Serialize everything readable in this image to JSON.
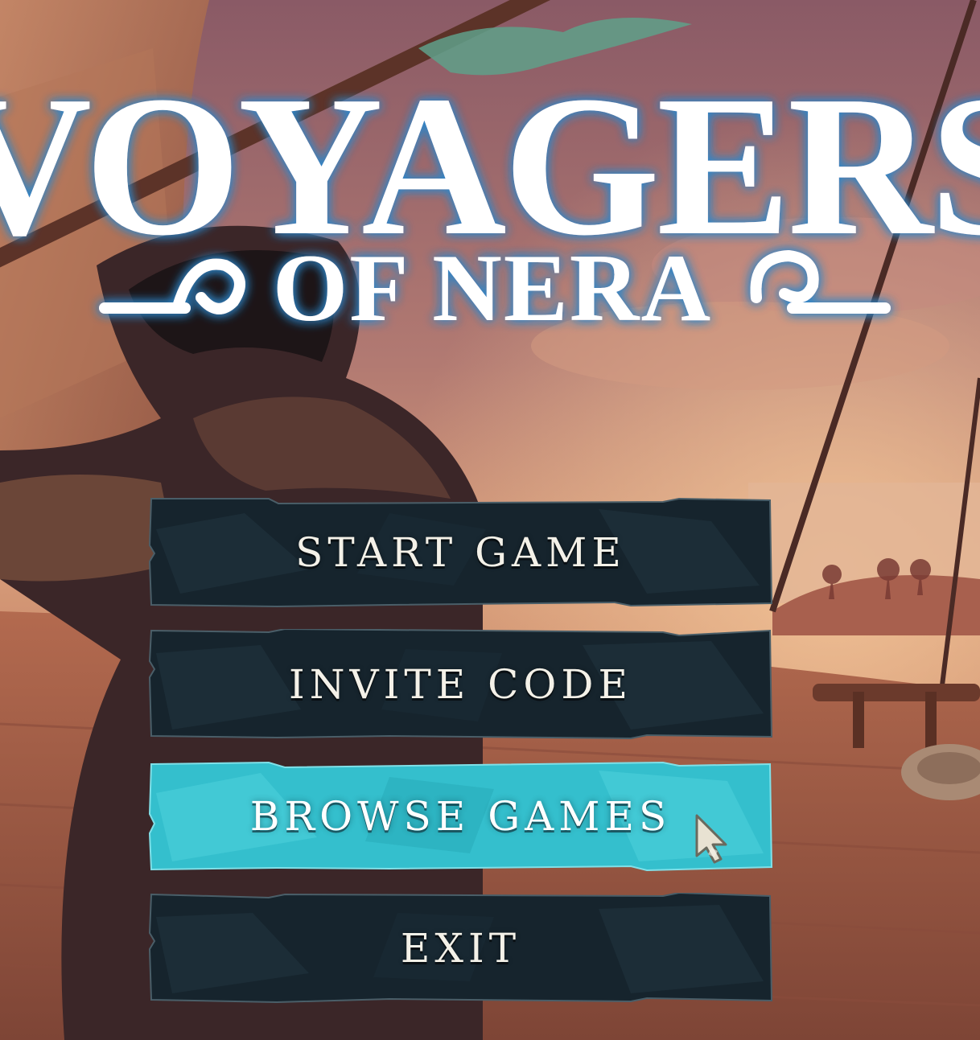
{
  "game": {
    "title_line1": "VOYAGERS",
    "title_line2": "OF NERA"
  },
  "menu": {
    "items": [
      {
        "id": "start-game",
        "label": "START GAME",
        "state": "normal"
      },
      {
        "id": "invite-code",
        "label": "INVITE CODE",
        "state": "normal"
      },
      {
        "id": "browse-games",
        "label": "BROWSE GAMES",
        "state": "hovered"
      },
      {
        "id": "exit",
        "label": "EXIT",
        "state": "normal"
      }
    ]
  },
  "colors": {
    "button_normal": "#16242d",
    "button_hover": "#34bfcd",
    "title": "#ffffff",
    "title_glow": "#2f86c9"
  },
  "icons": {
    "cursor": "arrow-cursor-icon",
    "title_ornament": "wave-swirl-icon"
  }
}
